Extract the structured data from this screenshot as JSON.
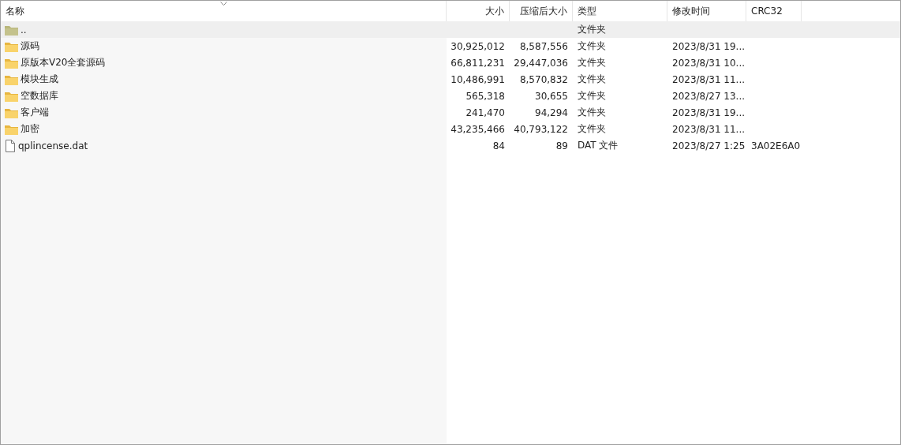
{
  "columns": [
    {
      "label": "名称",
      "sorted": true
    },
    {
      "label": "大小",
      "sorted": false
    },
    {
      "label": "压缩后大小",
      "sorted": false
    },
    {
      "label": "类型",
      "sorted": false
    },
    {
      "label": "修改时间",
      "sorted": false
    },
    {
      "label": "CRC32",
      "sorted": false
    }
  ],
  "rows": [
    {
      "kind": "parent",
      "selected": true,
      "cells": [
        "..",
        "",
        "",
        "文件夹",
        "",
        ""
      ]
    },
    {
      "kind": "folder",
      "selected": false,
      "cells": [
        "源码",
        "30,925,012",
        "8,587,556",
        "文件夹",
        "2023/8/31 19...",
        ""
      ]
    },
    {
      "kind": "folder",
      "selected": false,
      "cells": [
        "原版本V20全套源码",
        "66,811,231",
        "29,447,036",
        "文件夹",
        "2023/8/31 10...",
        ""
      ]
    },
    {
      "kind": "folder",
      "selected": false,
      "cells": [
        "模块生成",
        "10,486,991",
        "8,570,832",
        "文件夹",
        "2023/8/31 11...",
        ""
      ]
    },
    {
      "kind": "folder",
      "selected": false,
      "cells": [
        "空数据库",
        "565,318",
        "30,655",
        "文件夹",
        "2023/8/27 13...",
        ""
      ]
    },
    {
      "kind": "folder",
      "selected": false,
      "cells": [
        "客户端",
        "241,470",
        "94,294",
        "文件夹",
        "2023/8/31 19...",
        ""
      ]
    },
    {
      "kind": "folder",
      "selected": false,
      "cells": [
        "加密",
        "43,235,466",
        "40,793,122",
        "文件夹",
        "2023/8/31 11...",
        ""
      ]
    },
    {
      "kind": "file",
      "selected": false,
      "cells": [
        "qplincense.dat",
        "84",
        "89",
        "DAT 文件",
        "2023/8/27 1:25",
        "3A02E6A0"
      ]
    }
  ]
}
